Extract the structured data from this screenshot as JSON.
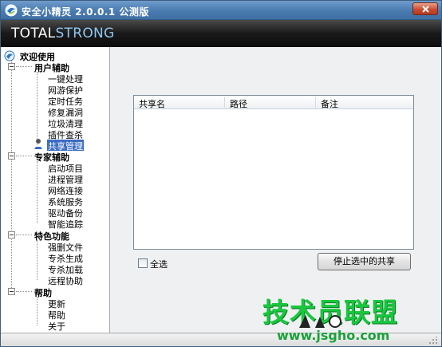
{
  "window": {
    "title": "安全小精灵  2.0.0.1  公测版"
  },
  "brand": {
    "part1": "TOTAL",
    "part2": "STRONG"
  },
  "sidebar": {
    "root_label": "欢迎使用",
    "groups": [
      {
        "label": "用户辅助",
        "items": [
          "一键处理",
          "网游保护",
          "定时任务",
          "修复漏洞",
          "垃圾清理",
          "插件查杀",
          "共享管理"
        ]
      },
      {
        "label": "专家辅助",
        "items": [
          "启动项目",
          "进程管理",
          "网络连接",
          "系统服务",
          "驱动备份",
          "智能追踪"
        ]
      },
      {
        "label": "特色功能",
        "items": [
          "强删文件",
          "专杀生成",
          "专杀加载",
          "远程协助"
        ]
      },
      {
        "label": "帮助",
        "items": [
          "更新",
          "帮助",
          "关于"
        ]
      }
    ],
    "selected_item": "共享管理"
  },
  "share_panel": {
    "columns": [
      "共享名",
      "路径",
      "备注"
    ],
    "rows": [],
    "select_all_label": "全选",
    "stop_button_label": "停止选中的共享"
  },
  "watermark": {
    "text": "技术员联盟",
    "url": "www.jsgho.com"
  },
  "colors": {
    "titlebar": "#4a7bb0",
    "brandbar": "#1a1a1a",
    "selection": "#3a6cc4",
    "watermark": "#19c73e"
  }
}
